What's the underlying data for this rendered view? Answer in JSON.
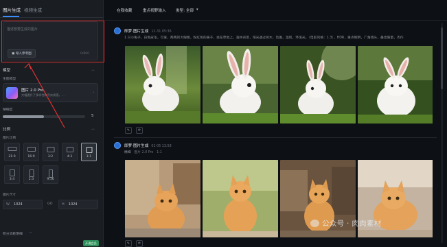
{
  "left_panel": {
    "tabs": [
      "图片生成",
      "视频生成"
    ],
    "prompt": {
      "placeholder": "描述想要生成的图片",
      "ref_button": "导入参考图",
      "counter": "0/800"
    },
    "model_section": {
      "title": "模型",
      "sub": "生图模型",
      "name": "图片 2.0 Pro",
      "desc": "大幅提升了多样性和写实质感，…"
    },
    "quality": {
      "label": "精细度",
      "value": "5",
      "fraction": 0.5
    },
    "ratio_section": {
      "title": "比例",
      "sub": "图片比例",
      "options": [
        "21:9",
        "16:9",
        "3:2",
        "4:3",
        "1:1",
        "3:4",
        "2:3",
        "9:16"
      ],
      "selected": "1:1"
    },
    "size": {
      "label": "图片尺寸",
      "w_key": "W",
      "w": "1024",
      "link": "GO",
      "h_key": "H",
      "h": "1024"
    },
    "bottom_label": "积分消耗明细",
    "badge": "开通会员"
  },
  "top_nav": {
    "items": [
      "在我收藏",
      "重点视野输入",
      "类型: 全部"
    ]
  },
  "entries": [
    {
      "title": "即梦·图片生成",
      "time": "12-31  05:36",
      "meta": "1 只小兔子，白色皮毛，可爱，两两的大眼睛，粉红色的鼻子，坐在草地上，森林背景，阳光透过树木，氛围，温和，环境光，（电影风格：1.3），HDR，重点照明，广角镜头，最佳质量，杰作"
    },
    {
      "title": "即梦·图片生成",
      "time": "01-05  13:58",
      "meta_a": "精细",
      "meta_b": "图片 2.0 Pro",
      "meta_c": "1:1"
    }
  ],
  "watermark": "公众号 · 肉肉素材",
  "colors": {
    "accent": "#3a8dff",
    "highlight": "#e23232",
    "badge": "#2e8f5a"
  }
}
